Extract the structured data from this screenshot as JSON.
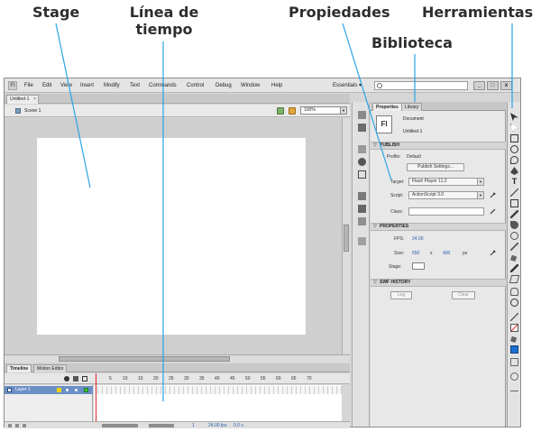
{
  "callouts": {
    "stage": "Stage",
    "timeline": "Línea de tiempo",
    "properties": "Propiedades",
    "library": "Biblioteca",
    "tools": "Herramientas"
  },
  "menubar": {
    "app_logo": "Fl",
    "items": [
      "File",
      "Edit",
      "View",
      "Insert",
      "Modify",
      "Text",
      "Commands",
      "Control",
      "Debug",
      "Window",
      "Help"
    ],
    "workspace": "Essentials ▾",
    "search_placeholder": "",
    "minimize": "_",
    "restore": "□",
    "close": "x"
  },
  "document": {
    "tab_name": "Untitled-1",
    "tab_close": "×",
    "scene": "Scene 1",
    "zoom": "100%"
  },
  "timeline": {
    "tabs": [
      "Timeline",
      "Motion Editor"
    ],
    "frame_numbers": [
      "5",
      "10",
      "15",
      "20",
      "25",
      "30",
      "35",
      "40",
      "45",
      "50",
      "55",
      "60",
      "65",
      "70"
    ],
    "layer_name": "Layer 1",
    "footer": {
      "current_frame": "1",
      "fps": "24.00 fps",
      "time": "0.0 s"
    }
  },
  "properties": {
    "tabs": [
      "Properties",
      "Library"
    ],
    "doc_icon": "Fl",
    "doc_type": "Document",
    "doc_name": "Untitled-1",
    "publish": {
      "header": "PUBLISH",
      "profile_label": "Profile:",
      "profile_value": "Default",
      "settings_button": "Publish Settings...",
      "target_label": "Target:",
      "target_value": "Flash Player 11.2",
      "script_label": "Script:",
      "script_value": "ActionScript 3.0",
      "class_label": "Class:"
    },
    "props": {
      "header": "PROPERTIES",
      "fps_label": "FPS:",
      "fps_value": "24.00",
      "size_label": "Size:",
      "width": "550",
      "x": "x",
      "height": "400",
      "unit": "px",
      "stage_label": "Stage:"
    },
    "history": {
      "header": "SWF HISTORY",
      "log_button": "Log",
      "clear_button": "Clear"
    }
  },
  "colors": {
    "accent_line": "#2aa3e6",
    "layer_highlight": "#6b8fc5",
    "fill_color": "#1a6fd1",
    "playhead": "#e02020"
  }
}
